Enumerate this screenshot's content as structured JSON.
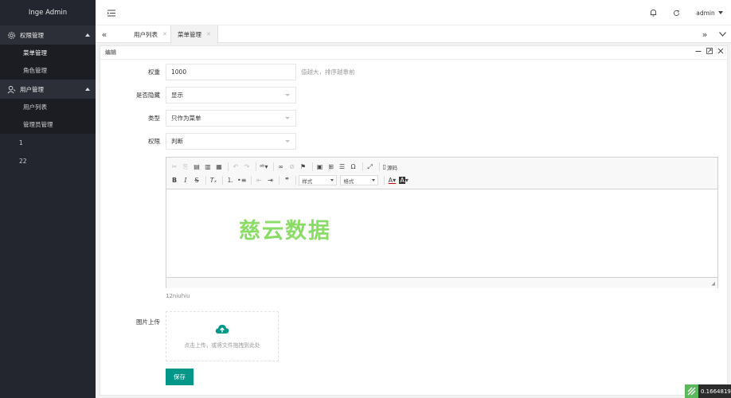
{
  "app": {
    "title": "Inge Admin"
  },
  "sidebar": {
    "groups": [
      {
        "label": "权限管理",
        "items": [
          "菜单管理",
          "角色管理"
        ]
      },
      {
        "label": "用户管理",
        "items": [
          "用户列表",
          "管理员管理"
        ]
      }
    ],
    "extra": [
      "1",
      "22"
    ]
  },
  "header": {
    "user": "admin"
  },
  "tabs": [
    {
      "label": "用户列表"
    },
    {
      "label": "菜单管理"
    }
  ],
  "panel": {
    "title": "编辑"
  },
  "form": {
    "weight_label": "权重",
    "weight_value": "1000",
    "weight_hint": "值越大，排序越靠前",
    "hidden_label": "是否隐藏",
    "hidden_value": "显示",
    "type_label": "类型",
    "type_value": "只作为菜单",
    "perm_label": "权限",
    "perm_value": "判断",
    "style_combo": "样式",
    "format_combo": "格式",
    "source_label": "源码",
    "editor_note": "12niuhiu",
    "upload_label": "图片上传",
    "upload_text": "点击上传，或将文件拖拽到此处",
    "save_label": "保存"
  },
  "watermark": "慈云数据",
  "badge": {
    "value": "0.1664819"
  },
  "colors": {
    "sidebar": "#23262e",
    "primary": "#009688",
    "watermark": "#7ed957"
  }
}
